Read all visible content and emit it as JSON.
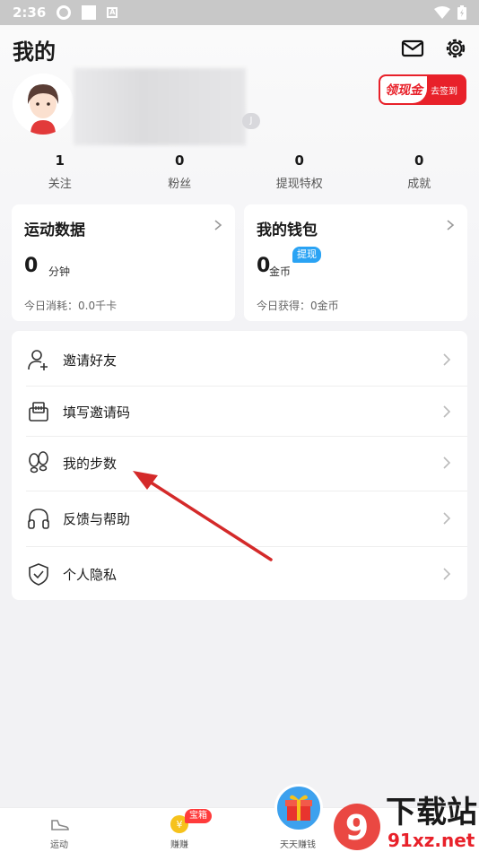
{
  "status_bar": {
    "time": "2:36",
    "mode_letter": "A"
  },
  "page": {
    "title": "我的"
  },
  "profile": {
    "level_letter": "J",
    "cash_badge": {
      "main": "领现金",
      "action": "去签到"
    }
  },
  "stats": [
    {
      "value": "1",
      "label": "关注"
    },
    {
      "value": "0",
      "label": "粉丝"
    },
    {
      "value": "0",
      "label": "提现特权"
    },
    {
      "value": "0",
      "label": "成就"
    }
  ],
  "cards": {
    "sport": {
      "title": "运动数据",
      "value": "0",
      "unit": "分钟",
      "sub": "今日消耗：0.0千卡"
    },
    "wallet": {
      "title": "我的钱包",
      "value": "0",
      "unit": "金币",
      "tag": "提现",
      "sub": "今日获得：0金币"
    }
  },
  "menu": [
    {
      "label": "邀请好友",
      "icon": "add-user-icon"
    },
    {
      "label": "填写邀请码",
      "icon": "invite-code-icon"
    },
    {
      "label": "我的步数",
      "icon": "footprints-icon"
    },
    {
      "label": "反馈与帮助",
      "icon": "headphones-icon"
    },
    {
      "label": "个人隐私",
      "icon": "shield-check-icon"
    }
  ],
  "tabbar": {
    "tabs": [
      {
        "label": "运动",
        "icon": "sneaker-icon"
      },
      {
        "label": "赚赚",
        "icon": "coin-icon",
        "badge": "宝箱"
      },
      {
        "label": "天天赚钱",
        "icon": "gift-icon"
      }
    ]
  },
  "watermark": {
    "line1": "下载站",
    "line2": "91xz.net",
    "number": "9"
  },
  "colors": {
    "accent_red": "#e8212a",
    "accent_blue": "#2aa3f4",
    "annotation_arrow": "#d42a2a"
  }
}
